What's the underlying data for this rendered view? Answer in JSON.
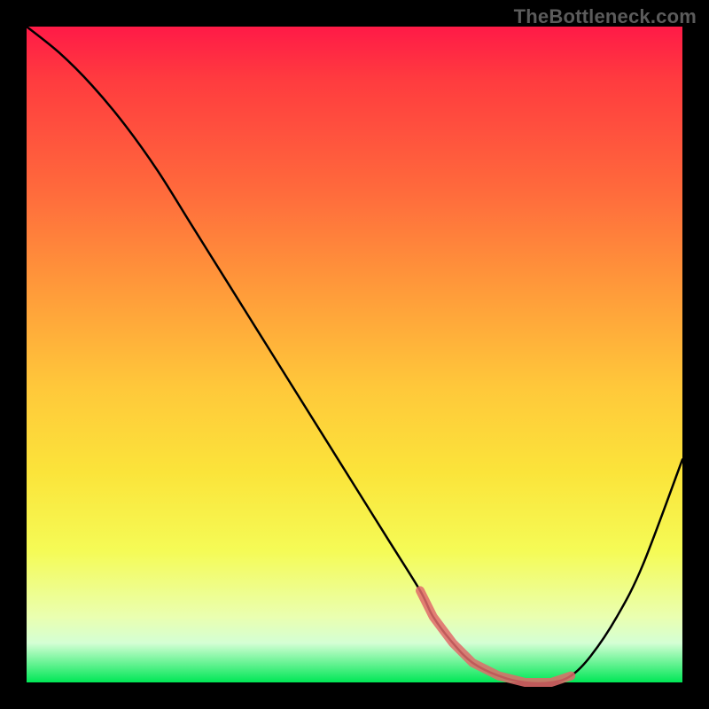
{
  "watermark": "TheBottleneck.com",
  "chart_data": {
    "type": "line",
    "title": "",
    "xlabel": "",
    "ylabel": "",
    "xlim": [
      0,
      100
    ],
    "ylim": [
      0,
      100
    ],
    "series": [
      {
        "name": "curve",
        "x": [
          0,
          5,
          10,
          15,
          20,
          25,
          30,
          35,
          40,
          45,
          50,
          55,
          60,
          62,
          65,
          68,
          72,
          76,
          80,
          83,
          86,
          90,
          94,
          100
        ],
        "values": [
          100,
          96,
          91,
          85,
          78,
          70,
          62,
          54,
          46,
          38,
          30,
          22,
          14,
          10,
          6,
          3,
          1,
          0,
          0,
          1,
          4,
          10,
          18,
          34
        ]
      }
    ],
    "highlight_band": {
      "x_start": 60,
      "x_end": 83,
      "color": "#e06a6a"
    },
    "background_gradient": [
      "#ff1a47",
      "#ff6a3c",
      "#ffc83a",
      "#f5fb56",
      "#00e756"
    ]
  }
}
